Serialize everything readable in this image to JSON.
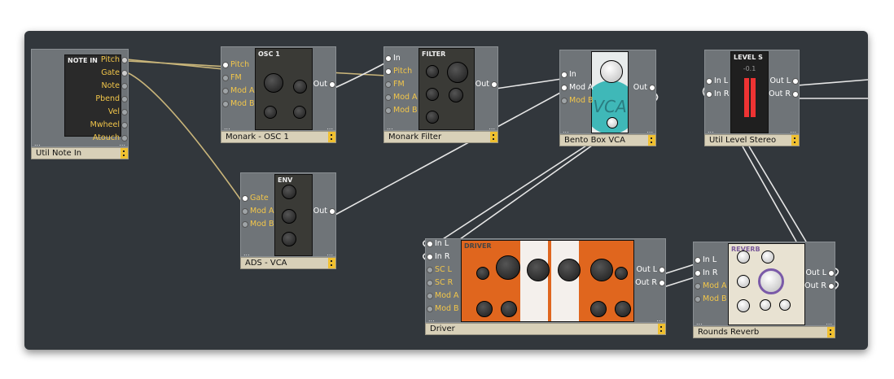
{
  "colors": {
    "canvas": "#32373c",
    "module": "#6f7478",
    "title_bar": "#d8d0b8",
    "menu": "#f0c030",
    "port_label_mod": "#f2c64a",
    "port_label_audio": "#ffffff",
    "cable_note": "#c9b57a",
    "cable_audio": "#e6e6e6"
  },
  "modules": [
    {
      "name": "Util Note In",
      "panel_title": "NOTE IN",
      "panel_color": "#2a2a2a",
      "inputs": [],
      "outputs": [
        {
          "label": "Pitch",
          "on": true
        },
        {
          "label": "Gate",
          "on": true
        },
        {
          "label": "Note"
        },
        {
          "label": "Pbend"
        },
        {
          "label": "Vel"
        },
        {
          "label": "Mwheel"
        },
        {
          "label": "Atouch"
        }
      ]
    },
    {
      "name": "Monark - OSC 1",
      "panel_title": "OSC 1",
      "panel_color": "#3a3a36",
      "inputs": [
        {
          "label": "Pitch",
          "on": true
        },
        {
          "label": "FM"
        },
        {
          "label": "Mod A"
        },
        {
          "label": "Mod B"
        }
      ],
      "outputs": [
        {
          "label": "Out",
          "on": true,
          "audio": true
        }
      ]
    },
    {
      "name": "Monark Filter",
      "panel_title": "FILTER",
      "panel_color": "#3a3a36",
      "inputs": [
        {
          "label": "In",
          "on": true,
          "audio": true
        },
        {
          "label": "Pitch",
          "on": true
        },
        {
          "label": "FM"
        },
        {
          "label": "Mod A"
        },
        {
          "label": "Mod B"
        }
      ],
      "outputs": [
        {
          "label": "Out",
          "on": true,
          "audio": true
        }
      ]
    },
    {
      "name": "Bento Box VCA",
      "panel_title": "VCA",
      "panel_color": "#e8ecec",
      "inputs": [
        {
          "label": "In",
          "on": true,
          "audio": true
        },
        {
          "label": "Mod A",
          "on": true,
          "audio": true
        },
        {
          "label": "Mod B"
        }
      ],
      "outputs": [
        {
          "label": "Out",
          "on": true,
          "audio": true
        }
      ]
    },
    {
      "name": "Util Level Stereo",
      "panel_title": "LEVEL S",
      "panel_color": "#1f1f1f",
      "readout": "-0.1",
      "inputs": [
        {
          "label": "In L",
          "on": true,
          "audio": true
        },
        {
          "label": "In R",
          "on": true,
          "audio": true
        }
      ],
      "outputs": [
        {
          "label": "Out L",
          "on": true,
          "audio": true
        },
        {
          "label": "Out R",
          "on": true,
          "audio": true
        }
      ]
    },
    {
      "name": "ADS - VCA",
      "panel_title": "ENV",
      "panel_color": "#3a3a36",
      "inputs": [
        {
          "label": "Gate",
          "on": true
        },
        {
          "label": "Mod A"
        },
        {
          "label": "Mod B"
        }
      ],
      "outputs": [
        {
          "label": "Out",
          "on": true,
          "audio": true
        }
      ]
    },
    {
      "name": "Driver",
      "panel_title": "DRIVER",
      "panel_color": "#e0661e",
      "inputs": [
        {
          "label": "In L",
          "on": true,
          "audio": true
        },
        {
          "label": "In R",
          "on": true,
          "audio": true
        },
        {
          "label": "SC L"
        },
        {
          "label": "SC R"
        },
        {
          "label": "Mod A"
        },
        {
          "label": "Mod B"
        }
      ],
      "outputs": [
        {
          "label": "Out L",
          "on": true,
          "audio": true
        },
        {
          "label": "Out R",
          "on": true,
          "audio": true
        }
      ]
    },
    {
      "name": "Rounds Reverb",
      "panel_title": "REVERB",
      "panel_color": "#e8e2d2",
      "inputs": [
        {
          "label": "In L",
          "on": true,
          "audio": true
        },
        {
          "label": "In R",
          "on": true,
          "audio": true
        },
        {
          "label": "Mod A"
        },
        {
          "label": "Mod B"
        }
      ],
      "outputs": [
        {
          "label": "Out L",
          "on": true,
          "audio": true
        },
        {
          "label": "Out R",
          "on": true,
          "audio": true
        }
      ]
    }
  ]
}
